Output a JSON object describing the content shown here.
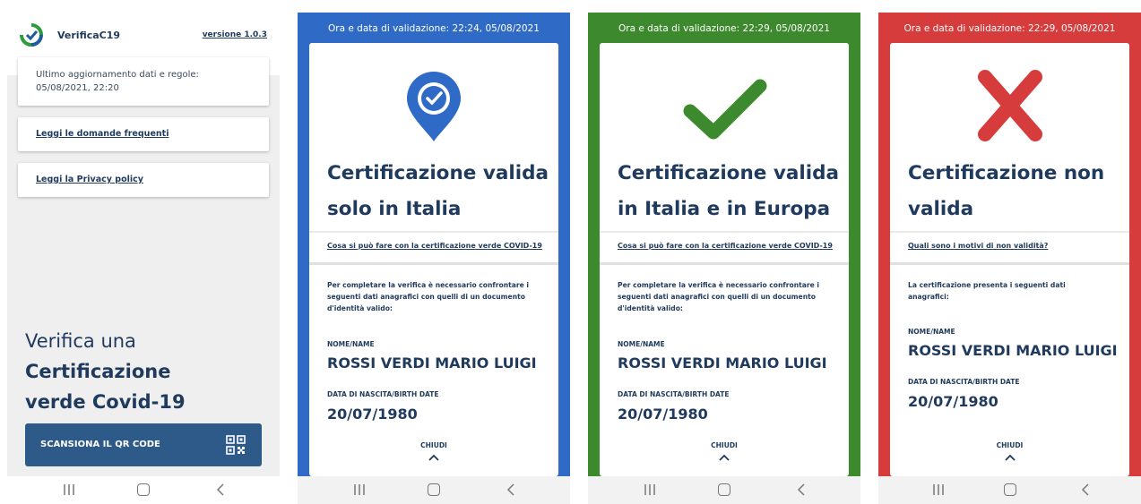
{
  "home": {
    "app_name": "VerificaC19",
    "version": "versione 1.0.3",
    "update_label": "Ultimo aggiornamento dati e regole:",
    "update_value": "05/08/2021, 22:20",
    "faq_link": "Leggi le domande frequenti",
    "privacy_link": "Leggi la Privacy policy",
    "verify_line1": "Verifica una",
    "verify_line2": "Certificazione",
    "verify_line3": "verde Covid-19",
    "scan_button": "SCANSIONA IL QR CODE"
  },
  "results": [
    {
      "header": "Ora e data di validazione: 22:24, 05/08/2021",
      "title_line1": "Certificazione valida",
      "title_line2": "solo in Italia",
      "link": "Cosa si può fare con la certificazione verde COVID-19",
      "instruction": "Per completare la verifica è necessario confrontare i seguenti dati anagrafici con quelli di un documento d'identità valido:",
      "name_label": "NOME/NAME",
      "name_value": "ROSSI VERDI MARIO LUIGI",
      "birth_label": "DATA DI NASCITA/BIRTH DATE",
      "birth_value": "20/07/1980",
      "close": "CHIUDI",
      "color": "#2f6ac7",
      "icon": "verified-pin-icon"
    },
    {
      "header": "Ora e data di validazione: 22:29, 05/08/2021",
      "title_line1": "Certificazione valida",
      "title_line2": "in Italia e in Europa",
      "link": "Cosa si può fare con la certificazione verde COVID-19",
      "instruction": "Per completare la verifica è necessario confrontare i seguenti dati anagrafici con quelli di un documento d'identità valido:",
      "name_label": "NOME/NAME",
      "name_value": "ROSSI VERDI MARIO LUIGI",
      "birth_label": "DATA DI NASCITA/BIRTH DATE",
      "birth_value": "20/07/1980",
      "close": "CHIUDI",
      "color": "#3d8a2e",
      "icon": "checkmark-icon"
    },
    {
      "header": "Ora e data di validazione: 22:29, 05/08/2021",
      "title_line1": "Certificazione non",
      "title_line2": "valida",
      "link": "Quali sono i motivi di non validità?",
      "instruction": "La certificazione presenta i seguenti dati anagrafici:",
      "name_label": "NOME/NAME",
      "name_value": "ROSSI VERDI MARIO LUIGI",
      "birth_label": "DATA DI NASCITA/BIRTH DATE",
      "birth_value": "20/07/1980",
      "close": "CHIUDI",
      "color": "#d63c3c",
      "icon": "cross-icon"
    }
  ],
  "colors": {
    "navy": "#1f3a5c",
    "button": "#2e5a89"
  }
}
